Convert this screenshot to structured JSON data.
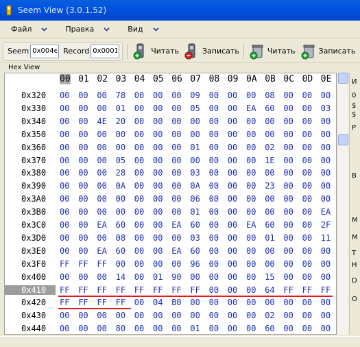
{
  "window": {
    "title": "Seem View (3.0.1.52)"
  },
  "menu": {
    "items": [
      {
        "label": "Файл"
      },
      {
        "label": "Правка"
      },
      {
        "label": "Вид"
      }
    ]
  },
  "toolbar": {
    "seem_label": "Seem",
    "seem_value": "0x004e",
    "record_label": "Record",
    "record_value": "0x0001",
    "read1_label": "Читать",
    "write1_label": "Записать",
    "read2_label": "Читать",
    "write2_label": "Записать"
  },
  "panel": {
    "title": "Hex View"
  },
  "hex": {
    "columns": [
      "00",
      "01",
      "02",
      "03",
      "04",
      "05",
      "06",
      "07",
      "08",
      "09",
      "0A",
      "0B",
      "0C",
      "0D",
      "0E"
    ],
    "selected_address": "0x410",
    "rows": [
      {
        "addr": "0x320",
        "bytes": [
          "00",
          "00",
          "00",
          "78",
          "00",
          "00",
          "00",
          "09",
          "00",
          "00",
          "00",
          "08",
          "00",
          "00",
          "00"
        ]
      },
      {
        "addr": "0x330",
        "bytes": [
          "00",
          "00",
          "00",
          "01",
          "00",
          "00",
          "00",
          "05",
          "00",
          "00",
          "EA",
          "60",
          "00",
          "00",
          "03"
        ]
      },
      {
        "addr": "0x340",
        "bytes": [
          "00",
          "00",
          "4E",
          "20",
          "00",
          "00",
          "00",
          "00",
          "00",
          "00",
          "00",
          "00",
          "00",
          "00",
          "00"
        ]
      },
      {
        "addr": "0x350",
        "bytes": [
          "00",
          "00",
          "00",
          "00",
          "00",
          "00",
          "00",
          "00",
          "00",
          "00",
          "00",
          "00",
          "00",
          "00",
          "00"
        ]
      },
      {
        "addr": "0x360",
        "bytes": [
          "00",
          "00",
          "00",
          "00",
          "00",
          "00",
          "00",
          "01",
          "00",
          "00",
          "00",
          "02",
          "00",
          "00",
          "00"
        ]
      },
      {
        "addr": "0x370",
        "bytes": [
          "00",
          "00",
          "00",
          "05",
          "00",
          "00",
          "00",
          "00",
          "00",
          "00",
          "00",
          "1E",
          "00",
          "00",
          "00"
        ]
      },
      {
        "addr": "0x380",
        "bytes": [
          "00",
          "00",
          "00",
          "28",
          "00",
          "00",
          "00",
          "03",
          "00",
          "00",
          "00",
          "00",
          "00",
          "00",
          "00"
        ]
      },
      {
        "addr": "0x390",
        "bytes": [
          "00",
          "00",
          "00",
          "0A",
          "00",
          "00",
          "00",
          "0A",
          "00",
          "00",
          "00",
          "23",
          "00",
          "00",
          "00"
        ]
      },
      {
        "addr": "0x3A0",
        "bytes": [
          "00",
          "00",
          "00",
          "00",
          "00",
          "00",
          "00",
          "06",
          "00",
          "00",
          "00",
          "00",
          "00",
          "00",
          "00"
        ]
      },
      {
        "addr": "0x3B0",
        "bytes": [
          "00",
          "00",
          "00",
          "00",
          "00",
          "00",
          "00",
          "01",
          "00",
          "00",
          "00",
          "00",
          "00",
          "00",
          "EA"
        ]
      },
      {
        "addr": "0x3C0",
        "bytes": [
          "00",
          "00",
          "EA",
          "60",
          "00",
          "00",
          "EA",
          "60",
          "00",
          "00",
          "EA",
          "60",
          "00",
          "00",
          "2F"
        ]
      },
      {
        "addr": "0x3D0",
        "bytes": [
          "00",
          "00",
          "00",
          "08",
          "00",
          "00",
          "00",
          "03",
          "00",
          "00",
          "00",
          "01",
          "00",
          "00",
          "11"
        ]
      },
      {
        "addr": "0x3E0",
        "bytes": [
          "00",
          "00",
          "EA",
          "60",
          "00",
          "00",
          "EA",
          "60",
          "00",
          "00",
          "00",
          "00",
          "00",
          "00",
          "00"
        ]
      },
      {
        "addr": "0x3F0",
        "bytes": [
          "FF",
          "FF",
          "FF",
          "00",
          "00",
          "00",
          "00",
          "96",
          "00",
          "00",
          "00",
          "00",
          "00",
          "00",
          "00"
        ]
      },
      {
        "addr": "0x400",
        "bytes": [
          "00",
          "00",
          "00",
          "14",
          "00",
          "01",
          "90",
          "00",
          "00",
          "00",
          "00",
          "15",
          "00",
          "00",
          "00"
        ]
      },
      {
        "addr": "0x410",
        "bytes": [
          "FF",
          "FF",
          "FF",
          "FF",
          "FF",
          "FF",
          "FF",
          "FF",
          "00",
          "00",
          "00",
          "64",
          "FF",
          "FF",
          "FF"
        ]
      },
      {
        "addr": "0x420",
        "bytes": [
          "FF",
          "FF",
          "FF",
          "FF",
          "00",
          "04",
          "B0",
          "00",
          "00",
          "00",
          "00",
          "00",
          "00",
          "00",
          "00"
        ]
      },
      {
        "addr": "0x430",
        "bytes": [
          "00",
          "00",
          "00",
          "00",
          "00",
          "00",
          "00",
          "00",
          "00",
          "00",
          "00",
          "02",
          "00",
          "00",
          "00"
        ]
      },
      {
        "addr": "0x440",
        "bytes": [
          "00",
          "00",
          "00",
          "80",
          "00",
          "00",
          "00",
          "01",
          "00",
          "00",
          "00",
          "60",
          "00",
          "00",
          "00"
        ]
      }
    ]
  },
  "side": {
    "letters": [
      "И",
      "0",
      "$",
      "$",
      "P",
      "B",
      "M",
      "M",
      "T",
      "H",
      "D",
      "O"
    ]
  },
  "colors": {
    "hex_text": "#1c2db3",
    "highlight_line": "#e01b1b",
    "title_bar": "#0052e0"
  }
}
